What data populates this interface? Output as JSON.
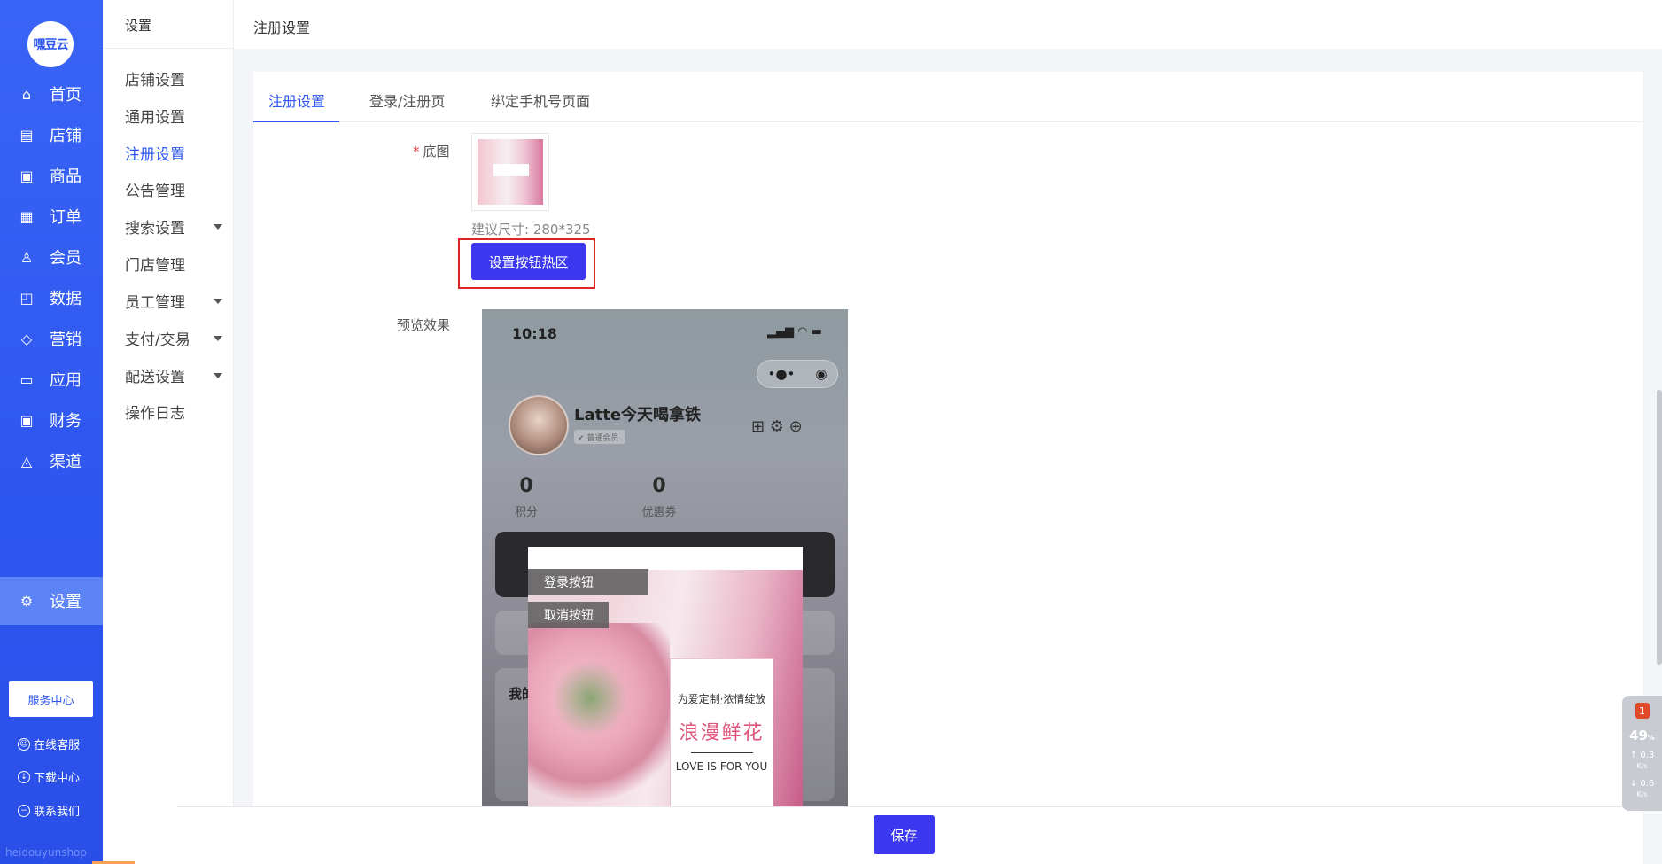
{
  "sidebar": {
    "logo": "嘿豆云",
    "items": [
      {
        "label": "首页",
        "icon": "home-icon",
        "glyph": "⌂"
      },
      {
        "label": "店铺",
        "icon": "store-icon",
        "glyph": "▤"
      },
      {
        "label": "商品",
        "icon": "product-icon",
        "glyph": "▣"
      },
      {
        "label": "订单",
        "icon": "order-icon",
        "glyph": "▦"
      },
      {
        "label": "会员",
        "icon": "member-icon",
        "glyph": "♙"
      },
      {
        "label": "数据",
        "icon": "chart-icon",
        "glyph": "◰"
      },
      {
        "label": "营销",
        "icon": "tag-icon",
        "glyph": "◇"
      },
      {
        "label": "应用",
        "icon": "app-icon",
        "glyph": "▭"
      },
      {
        "label": "财务",
        "icon": "finance-icon",
        "glyph": "▣"
      },
      {
        "label": "渠道",
        "icon": "channel-icon",
        "glyph": "◬"
      },
      {
        "label": "设置",
        "icon": "gear-icon",
        "glyph": "⚙"
      }
    ],
    "service_center": "服务中心",
    "footer_links": [
      {
        "label": "在线客服",
        "icon": "chat-icon"
      },
      {
        "label": "下载中心",
        "icon": "download-icon"
      },
      {
        "label": "联系我们",
        "icon": "contact-icon"
      }
    ],
    "watermark": "heidouyunshop"
  },
  "subnav": {
    "title": "设置",
    "items": [
      {
        "label": "店铺设置",
        "expand": false
      },
      {
        "label": "通用设置",
        "expand": false
      },
      {
        "label": "注册设置",
        "expand": false,
        "active": true
      },
      {
        "label": "公告管理",
        "expand": false
      },
      {
        "label": "搜索设置",
        "expand": true
      },
      {
        "label": "门店管理",
        "expand": false
      },
      {
        "label": "员工管理",
        "expand": true
      },
      {
        "label": "支付/交易",
        "expand": true
      },
      {
        "label": "配送设置",
        "expand": true
      },
      {
        "label": "操作日志",
        "expand": false
      }
    ]
  },
  "header": {
    "title": "注册设置"
  },
  "tabs": [
    {
      "label": "注册设置",
      "active": true
    },
    {
      "label": "登录/注册页"
    },
    {
      "label": "绑定手机号页面"
    }
  ],
  "form": {
    "base_image_label": "底图",
    "required_mark": "*",
    "size_hint": "建议尺寸: 280*325",
    "hotspot_button": "设置按钮热区",
    "preview_label": "预览效果"
  },
  "preview": {
    "time": "10:18",
    "status_icons": "▂▄▆ ◠ ▬",
    "capsule_menu": "•●•",
    "capsule_close": "◉",
    "username": "Latte今天喝拿铁",
    "member_tag": "✔ 普通会员",
    "top_icons": "⊞ ⚙ ⊕",
    "points_value": "0",
    "points_label": "积分",
    "coupons_value": "0",
    "coupons_label": "优惠券",
    "my_label": "我的",
    "hotspots": [
      "登录按钮",
      "取消按钮"
    ],
    "poster_line1": "为爱定制·浓情绽放",
    "poster_line2": "浪漫鲜花",
    "poster_line3": "LOVE IS FOR YOU"
  },
  "actions": {
    "save": "保存"
  },
  "widget": {
    "badge": "1",
    "percent": "49",
    "percent_unit": "%",
    "up_speed": "0.3",
    "down_speed": "0.6",
    "speed_unit": "K/s"
  },
  "colors": {
    "primary": "#2e56f0",
    "button": "#3b38ef",
    "highlight_border": "#e02424"
  }
}
